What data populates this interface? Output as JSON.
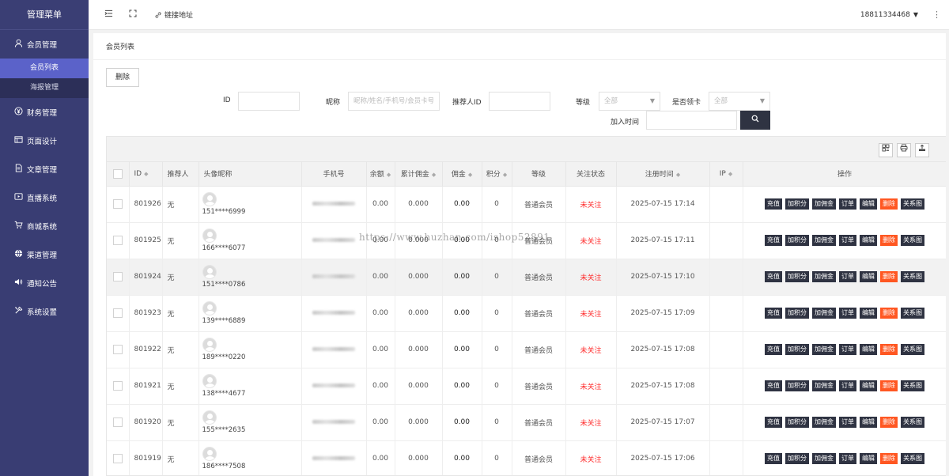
{
  "sidebar": {
    "title": "管理菜单",
    "groups": [
      {
        "label": "会员管理",
        "icon": "user-icon",
        "children": [
          {
            "label": "会员列表",
            "active": true
          },
          {
            "label": "海报管理",
            "active": false
          }
        ]
      },
      {
        "label": "财务管理",
        "icon": "yen-icon"
      },
      {
        "label": "页面设计",
        "icon": "layout-icon"
      },
      {
        "label": "文章管理",
        "icon": "document-icon"
      },
      {
        "label": "直播系统",
        "icon": "live-icon"
      },
      {
        "label": "商城系统",
        "icon": "cart-icon"
      },
      {
        "label": "渠道管理",
        "icon": "globe-icon"
      },
      {
        "label": "通知公告",
        "icon": "speaker-icon"
      },
      {
        "label": "系统设置",
        "icon": "tools-icon"
      }
    ]
  },
  "topbar": {
    "link_label": "链接地址",
    "username": "18811334468"
  },
  "page": {
    "breadcrumb": "会员列表",
    "delete_button": "删除"
  },
  "filters": {
    "id_label": "ID",
    "nickname_label": "昵称",
    "nickname_placeholder": "昵称/姓名/手机号/会员卡号",
    "referrer_label": "推荐人ID",
    "level_label": "等级",
    "level_value": "全部",
    "card_label": "是否领卡",
    "card_value": "全部",
    "join_time_label": "加入时间"
  },
  "table": {
    "headers": {
      "id": "ID",
      "referrer": "推荐人",
      "avatar_nick": "头像昵称",
      "phone": "手机号",
      "balance": "余额",
      "total_commission": "累计佣金",
      "commission": "佣金",
      "points": "积分",
      "level": "等级",
      "follow_status": "关注状态",
      "reg_time": "注册时间",
      "ip": "IP",
      "actions": "操作"
    },
    "action_labels": {
      "recharge": "充值",
      "add_points": "加积分",
      "add_commission": "加佣金",
      "orders": "订单",
      "edit": "编辑",
      "delete": "删除",
      "relation": "关系图"
    },
    "rows": [
      {
        "id": "801926",
        "referrer": "无",
        "nick": "151****6999",
        "balance": "0.00",
        "total_commission": "0.000",
        "commission": "0.00",
        "points": "0",
        "level": "普通会员",
        "follow": "未关注",
        "reg_time": "2025-07-15 17:14",
        "ip": ""
      },
      {
        "id": "801925",
        "referrer": "无",
        "nick": "166****6077",
        "balance": "0.00",
        "total_commission": "0.000",
        "commission": "0.00",
        "points": "0",
        "level": "普通会员",
        "follow": "未关注",
        "reg_time": "2025-07-15 17:11",
        "ip": ""
      },
      {
        "id": "801924",
        "referrer": "无",
        "nick": "151****0786",
        "balance": "0.00",
        "total_commission": "0.000",
        "commission": "0.00",
        "points": "0",
        "level": "普通会员",
        "follow": "未关注",
        "reg_time": "2025-07-15 17:10",
        "ip": ""
      },
      {
        "id": "801923",
        "referrer": "无",
        "nick": "139****6889",
        "balance": "0.00",
        "total_commission": "0.000",
        "commission": "0.00",
        "points": "0",
        "level": "普通会员",
        "follow": "未关注",
        "reg_time": "2025-07-15 17:09",
        "ip": ""
      },
      {
        "id": "801922",
        "referrer": "无",
        "nick": "189****0220",
        "balance": "0.00",
        "total_commission": "0.000",
        "commission": "0.00",
        "points": "0",
        "level": "普通会员",
        "follow": "未关注",
        "reg_time": "2025-07-15 17:08",
        "ip": ""
      },
      {
        "id": "801921",
        "referrer": "无",
        "nick": "138****4677",
        "balance": "0.00",
        "total_commission": "0.000",
        "commission": "0.00",
        "points": "0",
        "level": "普通会员",
        "follow": "未关注",
        "reg_time": "2025-07-15 17:08",
        "ip": ""
      },
      {
        "id": "801920",
        "referrer": "无",
        "nick": "155****2635",
        "balance": "0.00",
        "total_commission": "0.000",
        "commission": "0.00",
        "points": "0",
        "level": "普通会员",
        "follow": "未关注",
        "reg_time": "2025-07-15 17:07",
        "ip": ""
      },
      {
        "id": "801919",
        "referrer": "无",
        "nick": "186****7508",
        "balance": "0.00",
        "total_commission": "0.000",
        "commission": "0.00",
        "points": "0",
        "level": "普通会员",
        "follow": "未关注",
        "reg_time": "2025-07-15 17:06",
        "ip": ""
      }
    ]
  },
  "watermark": "https://www.huzhan.com/ishop52891",
  "colors": {
    "sidebar_bg": "#393d73",
    "active_item": "#5b62c9",
    "dark_button": "#2f3342",
    "danger_button": "#ff5722",
    "status_red": "#ff2a2a"
  }
}
